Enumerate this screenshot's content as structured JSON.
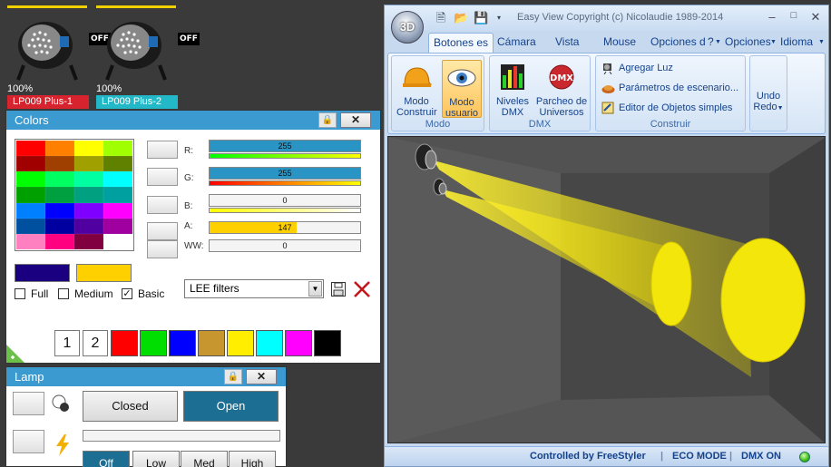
{
  "fixtures": [
    {
      "percent": "100%",
      "name": "LP009 Plus-1",
      "state": "OFF",
      "name_color": "#d6232e"
    },
    {
      "percent": "100%",
      "name": "LP009 Plus-2",
      "state": "OFF",
      "name_color": "#23b8c8"
    }
  ],
  "colors_panel": {
    "title": "Colors",
    "palette": [
      "#ff0000",
      "#ff8000",
      "#ffff00",
      "#a0ff00",
      "#a00000",
      "#a04000",
      "#a0a000",
      "#608000",
      "#00ff00",
      "#00ff60",
      "#00ffa0",
      "#00ffff",
      "#00a000",
      "#00a040",
      "#00a080",
      "#00a0a0",
      "#0080ff",
      "#0000ff",
      "#8000ff",
      "#ff00ff",
      "#0050a0",
      "#0000a0",
      "#5000a0",
      "#a000a0",
      "#ff80c0",
      "#ff0080",
      "#800040",
      "#ffffff"
    ],
    "selected_colors": [
      "#1a0080",
      "#ffd000"
    ],
    "checkboxes": [
      {
        "label": "Full",
        "checked": false
      },
      {
        "label": "Medium",
        "checked": false
      },
      {
        "label": "Basic",
        "checked": true
      }
    ],
    "channels": [
      {
        "label": "R:",
        "value": "255",
        "fill": 1.0,
        "color": "#2a94c4",
        "gradient": "linear-gradient(90deg, #00ff00, #ffff00)"
      },
      {
        "label": "G:",
        "value": "255",
        "fill": 1.0,
        "color": "#2a94c4",
        "gradient": "linear-gradient(90deg, #ff0000, #ffff00)"
      },
      {
        "label": "B:",
        "value": "0",
        "fill": 0,
        "color": "#2a94c4",
        "gradient": "linear-gradient(90deg, #ffff00, #ffffff)"
      },
      {
        "label": "A:",
        "value": "147",
        "fill": 0.576,
        "color": "#ffd000",
        "gradient": ""
      },
      {
        "label": "WW:",
        "value": "0",
        "fill": 0,
        "color": "#2a94c4",
        "gradient": ""
      }
    ],
    "filter_select": "LEE filters",
    "presets": [
      "1",
      "2"
    ],
    "preset_colors": [
      "#ff0000",
      "#00dd00",
      "#0000ff",
      "#c8962e",
      "#ffee00",
      "#00ffff",
      "#ff00ff",
      "#000000"
    ]
  },
  "lamp_panel": {
    "title": "Lamp",
    "closed_label": "Closed",
    "open_label": "Open",
    "levels": [
      "Off",
      "Low",
      "Med",
      "High"
    ]
  },
  "app": {
    "logo": "3D",
    "title": "Easy View   Copyright (c) Nicolaudie 1989-2014",
    "tabs": [
      "Botones es",
      "Cámara",
      "Vista",
      "Mouse",
      "Opciones d",
      "?",
      "Opciones",
      "Idioma"
    ],
    "groups": {
      "modo": {
        "label": "Modo",
        "buttons": [
          {
            "line1": "Modo",
            "line2": "Construir"
          },
          {
            "line1": "Modo",
            "line2": "usuario"
          }
        ]
      },
      "dmx": {
        "label": "DMX",
        "buttons": [
          {
            "line1": "Niveles",
            "line2": "DMX"
          },
          {
            "line1": "Parcheo de",
            "line2": "Universos"
          }
        ]
      },
      "construir": {
        "label": "Construir",
        "items": [
          "Agregar Luz",
          "Parámetros de escenario...",
          "Editor de Objetos simples"
        ]
      },
      "undo": {
        "line1": "Undo",
        "line2": "Redo"
      }
    },
    "status": [
      "Controlled by FreeStyler",
      "ECO MODE",
      "DMX ON"
    ]
  }
}
